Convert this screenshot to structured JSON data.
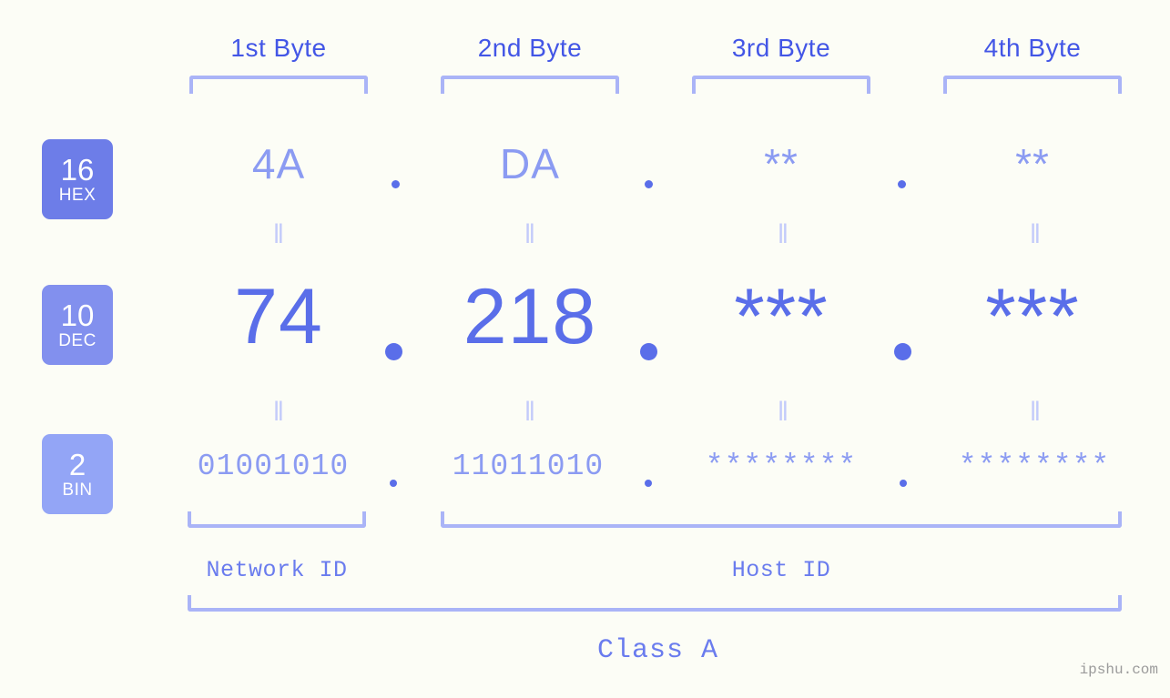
{
  "background_color": "#fcfdf6",
  "accent_colors": {
    "header_text": "#4356e6",
    "bracket": "#aab4f7",
    "hex_value": "#8b9bf2",
    "dec_value": "#5a6ee9",
    "bin_value": "#8b9bf2",
    "equals": "#c3cbfa",
    "badge_hex": "#6d7de8",
    "badge_dec": "#8290ee",
    "badge_bin": "#93a5f6",
    "watermark": "#9b9b9b"
  },
  "headers": [
    {
      "label": "1st Byte"
    },
    {
      "label": "2nd Byte"
    },
    {
      "label": "3rd Byte"
    },
    {
      "label": "4th Byte"
    }
  ],
  "bases": [
    {
      "number": "16",
      "name": "HEX"
    },
    {
      "number": "10",
      "name": "DEC"
    },
    {
      "number": "2",
      "name": "BIN"
    }
  ],
  "rows": {
    "hex": {
      "base_number": "16",
      "base_name": "HEX",
      "values": [
        "4A",
        "DA",
        "**",
        "**"
      ],
      "separators": [
        ".",
        ".",
        "."
      ]
    },
    "dec": {
      "base_number": "10",
      "base_name": "DEC",
      "values": [
        "74",
        "218",
        "***",
        "***"
      ],
      "separators": [
        ".",
        ".",
        "."
      ]
    },
    "bin": {
      "base_number": "2",
      "base_name": "BIN",
      "values": [
        "01001010",
        "11011010",
        "********",
        "********"
      ],
      "separators": [
        ".",
        ".",
        "."
      ]
    }
  },
  "equals_glyph": "‖",
  "segments": {
    "network_id": "Network ID",
    "host_id": "Host ID"
  },
  "class_label": "Class A",
  "watermark": "ipshu.com"
}
